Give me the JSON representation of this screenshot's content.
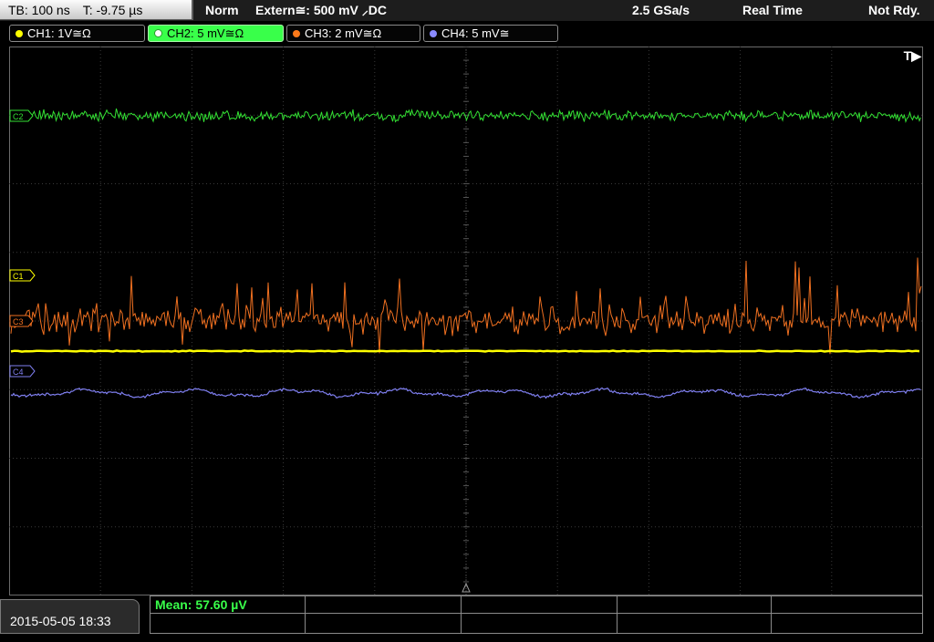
{
  "top_bar": {
    "timebase": "TB: 100 ns",
    "trigger_time": "T: -9.75 µs",
    "mode": "Norm",
    "trigger_source": "Extern≅: 500 mV ⸝DC",
    "sample_rate": "2.5 GSa/s",
    "acquire_mode": "Real Time",
    "status": "Not Rdy."
  },
  "channels": [
    {
      "label": "CH1: 1V≅Ω",
      "color": "#ffff00",
      "active": false
    },
    {
      "label": "CH2: 5 mV≅Ω",
      "color": "#39ff4a",
      "active": true
    },
    {
      "label": "CH3: 2 mV≅Ω",
      "color": "#ff7a1a",
      "active": false
    },
    {
      "label": "CH4: 5 mV≅",
      "color": "#8a8aff",
      "active": false
    }
  ],
  "markers": {
    "c1": "C1",
    "c2": "C2",
    "c3": "C3",
    "c4": "C4",
    "trigger": "T▶"
  },
  "bottom_bar": {
    "datetime": "2015-05-05 18:33",
    "measurement": "Mean: 57.60 µV"
  },
  "colors": {
    "ch1": "#ffff00",
    "ch2": "#33e033",
    "ch3": "#f07020",
    "ch4": "#7f7ff0",
    "grid": "#3a3a3a"
  }
}
